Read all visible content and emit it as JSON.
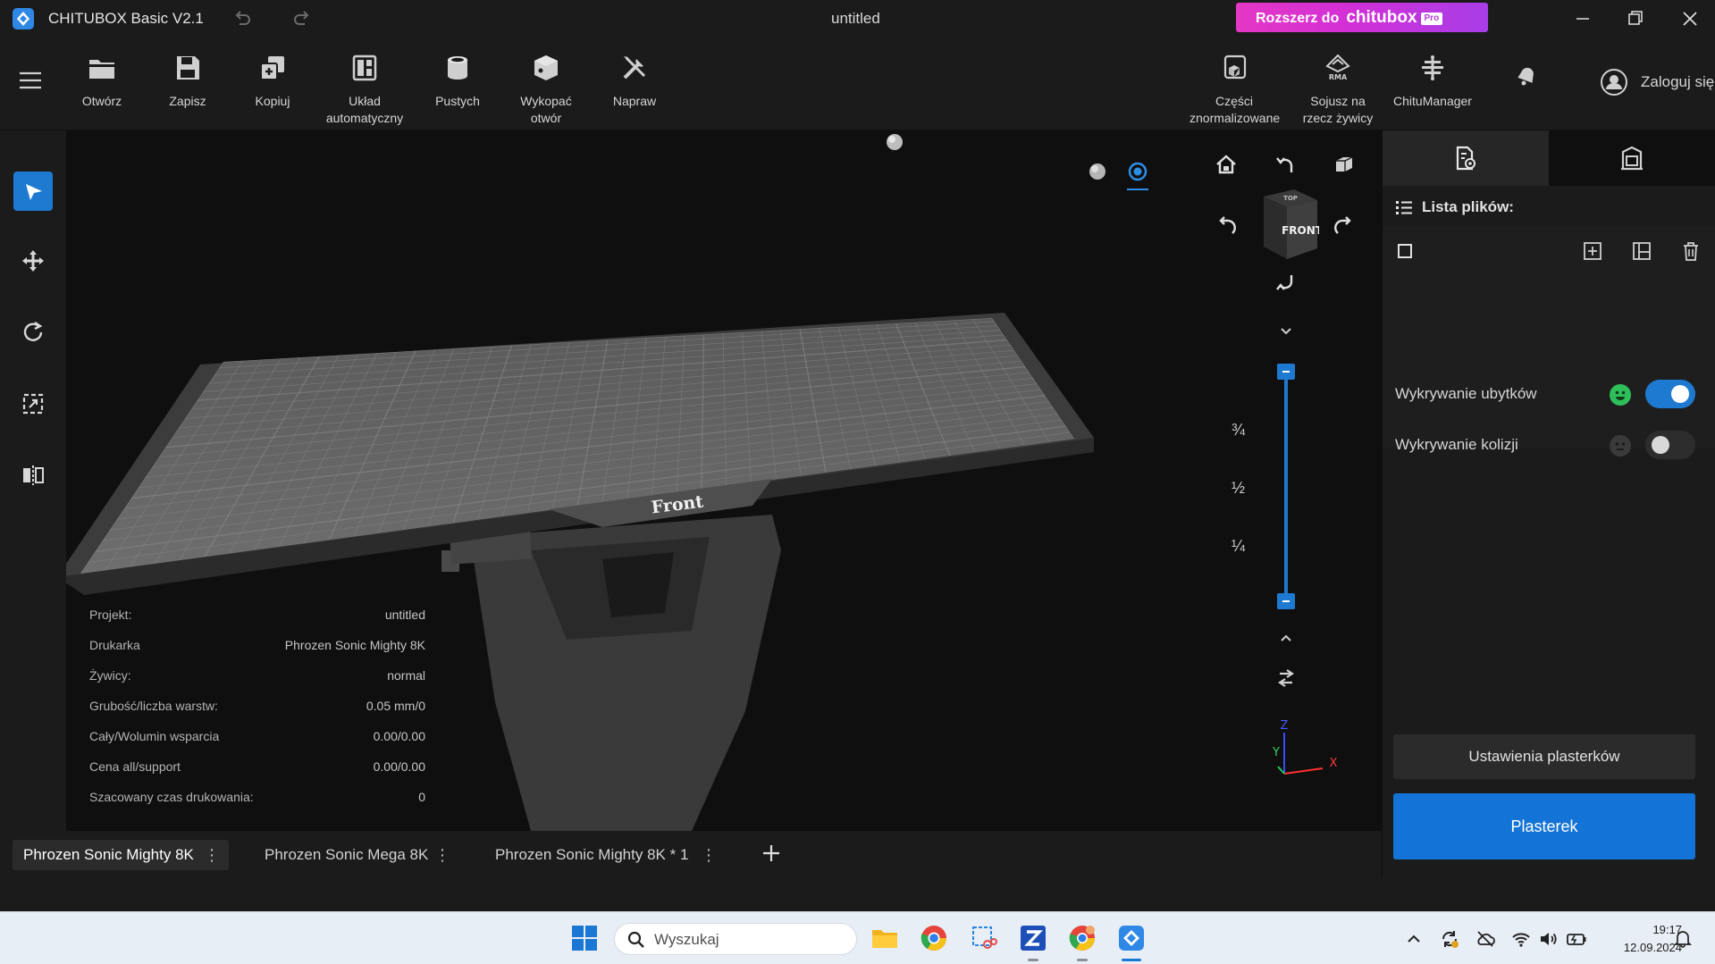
{
  "titlebar": {
    "app_title": "CHITUBOX Basic V2.1",
    "doc_title": "untitled",
    "upgrade_label": "Rozszerz do",
    "upgrade_brand": "chitubox",
    "upgrade_pro": "Pro"
  },
  "toolbar": {
    "open": "Otwórz",
    "save": "Zapisz",
    "copy": "Kopiuj",
    "auto_layout_1": "Układ",
    "auto_layout_2": "automatyczny",
    "hollow": "Pustych",
    "dig_hole_1": "Wykopać",
    "dig_hole_2": "otwór",
    "repair": "Napraw",
    "normalized_1": "Części",
    "normalized_2": "znormalizowane",
    "rma_1": "Sojusz na",
    "rma_2": "rzecz żywicy",
    "chitumanager": "ChituManager",
    "login": "Zaloguj się"
  },
  "info": {
    "rows": [
      {
        "k": "Projekt:",
        "v": "untitled"
      },
      {
        "k": "Drukarka",
        "v": "Phrozen Sonic Mighty 8K"
      },
      {
        "k": "Żywicy:",
        "v": "normal"
      },
      {
        "k": "Grubość/liczba warstw:",
        "v": "0.05 mm/0"
      },
      {
        "k": "Cały/Wolumin wsparcia",
        "v": "0.00/0.00"
      },
      {
        "k": "Cena all/support",
        "v": "0.00/0.00"
      },
      {
        "k": "Szacowany czas drukowania:",
        "v": "0"
      }
    ]
  },
  "viewport": {
    "plate_label": "Front",
    "cube_front": "FRONT",
    "cube_top": "TOP",
    "layer_marks": [
      "¾",
      "½",
      "¼"
    ],
    "axes": {
      "x": "X",
      "y": "Y",
      "z": "Z"
    }
  },
  "tabs": [
    {
      "label": "Phrozen Sonic Mighty 8K"
    },
    {
      "label": "Phrozen Sonic Mega 8K"
    },
    {
      "label": "Phrozen Sonic Mighty 8K * 1"
    }
  ],
  "rightpanel": {
    "file_list_title": "Lista plików:",
    "detect_holes": "Wykrywanie ubytków",
    "detect_collisions": "Wykrywanie kolizji",
    "slice_settings": "Ustawienia plasterków",
    "slice": "Plasterek"
  },
  "taskbar": {
    "search_placeholder": "Wyszukaj",
    "time": "19:17",
    "date": "12.09.2024"
  },
  "colors": {
    "accent": "#1e7ad0",
    "slice_button": "#1473d6",
    "upgrade_gradient_start": "#e437c4",
    "toggle_ok_face": "#2fbf5a"
  }
}
